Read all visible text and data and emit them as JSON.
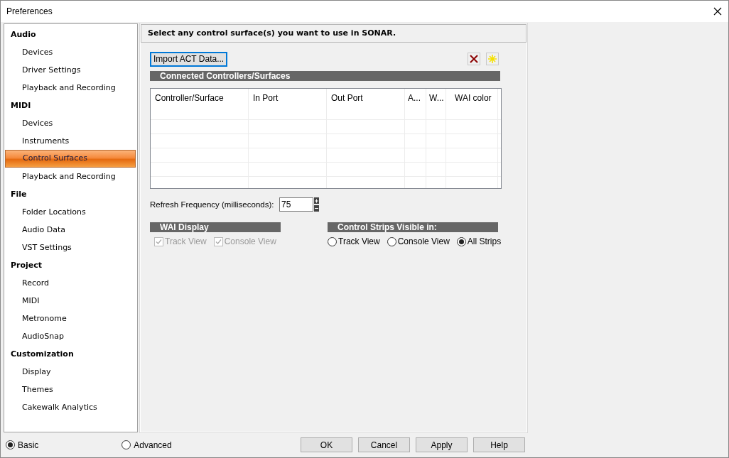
{
  "window": {
    "title": "Preferences"
  },
  "sidebar": {
    "groups": [
      {
        "label": "Audio",
        "children": [
          {
            "label": "Devices",
            "selected": false
          },
          {
            "label": "Driver Settings",
            "selected": false
          },
          {
            "label": "Playback and Recording",
            "selected": false
          }
        ]
      },
      {
        "label": "MIDI",
        "children": [
          {
            "label": "Devices",
            "selected": false
          },
          {
            "label": "Instruments",
            "selected": false
          },
          {
            "label": "Control Surfaces",
            "selected": true
          },
          {
            "label": "Playback and Recording",
            "selected": false
          }
        ]
      },
      {
        "label": "File",
        "children": [
          {
            "label": "Folder Locations",
            "selected": false
          },
          {
            "label": "Audio Data",
            "selected": false
          },
          {
            "label": "VST Settings",
            "selected": false
          }
        ]
      },
      {
        "label": "Project",
        "children": [
          {
            "label": "Record",
            "selected": false
          },
          {
            "label": "MIDI",
            "selected": false
          },
          {
            "label": "Metronome",
            "selected": false
          },
          {
            "label": "AudioSnap",
            "selected": false
          }
        ]
      },
      {
        "label": "Customization",
        "children": [
          {
            "label": "Display",
            "selected": false
          },
          {
            "label": "Themes",
            "selected": false
          },
          {
            "label": "Cakewalk Analytics",
            "selected": false
          }
        ]
      }
    ]
  },
  "panel": {
    "heading": "Select any control surface(s) you want to use in SONAR.",
    "import_button": "Import ACT Data...",
    "section_title": "Connected Controllers/Surfaces",
    "table": {
      "columns": [
        "Controller/Surface",
        "In Port",
        "Out Port",
        "A...",
        "W...",
        "WAI color"
      ]
    },
    "refresh": {
      "label": "Refresh Frequency (milliseconds):",
      "value": "75"
    },
    "wai_display": {
      "title": "WAI Display",
      "options": [
        {
          "label": "Track View",
          "checked": true,
          "disabled": true
        },
        {
          "label": "Console View",
          "checked": true,
          "disabled": true
        }
      ]
    },
    "strips": {
      "title": "Control Strips Visible in:",
      "options": [
        {
          "label": "Track View",
          "selected": false
        },
        {
          "label": "Console View",
          "selected": false
        },
        {
          "label": "All Strips",
          "selected": true
        }
      ]
    }
  },
  "mode": [
    {
      "label": "Basic",
      "selected": true
    },
    {
      "label": "Advanced",
      "selected": false
    }
  ],
  "buttons": [
    "OK",
    "Cancel",
    "Apply",
    "Help"
  ]
}
